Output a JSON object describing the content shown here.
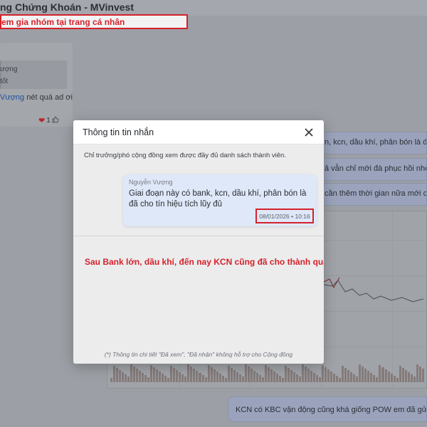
{
  "app": {
    "title": "ng Chứng Khoán - MVinvest",
    "join_banner": "em gia nhóm tại trang cá nhân"
  },
  "left_panel": {
    "quote_name": "ượng",
    "quote_text": "tốt",
    "message_mention": "Vượng",
    "message_rest": " nét quá ad ơi",
    "reaction_count": "1",
    "reaction_icon": "heart-icon",
    "like_icon": "thumbs-up-icon"
  },
  "right_messages": [
    "n, kcn, dầu khí, phân bón là đã cho",
    "ả vẫn chỉ mới đà phục hồi nhe,",
    "cần thêm thời gian nữa mới có s"
  ],
  "bottom_message": "KCN có KBC vận động cũng khá giống POW em đã gửi phí",
  "modal": {
    "title": "Thông tin tin nhắn",
    "close_icon": "close-icon",
    "info": "Chỉ trưởng/phó cộng đồng xem được đầy đủ danh sách thành viên.",
    "message": {
      "author": "Nguyễn Vượng",
      "text": "Giai đoạn này có bank, kcn, dầu khí, phân bón là đã cho tín hiệu tích lũy đủ",
      "timestamp": "08/01/2026 • 10:16"
    },
    "annotation": "Sau Bank lớn, dầu khí, đến nay KCN cũng đã cho thành quả",
    "footnote": "(*) Thông tin chi tiết \"Đã xem\", \"Đã nhận\" không hỗ trợ cho Cộng đồng"
  },
  "colors": {
    "accent_red": "#d4222a",
    "message_bubble": "#dfe8f8",
    "modal_bg": "#ececed",
    "overlay": "#9c9fa5"
  }
}
